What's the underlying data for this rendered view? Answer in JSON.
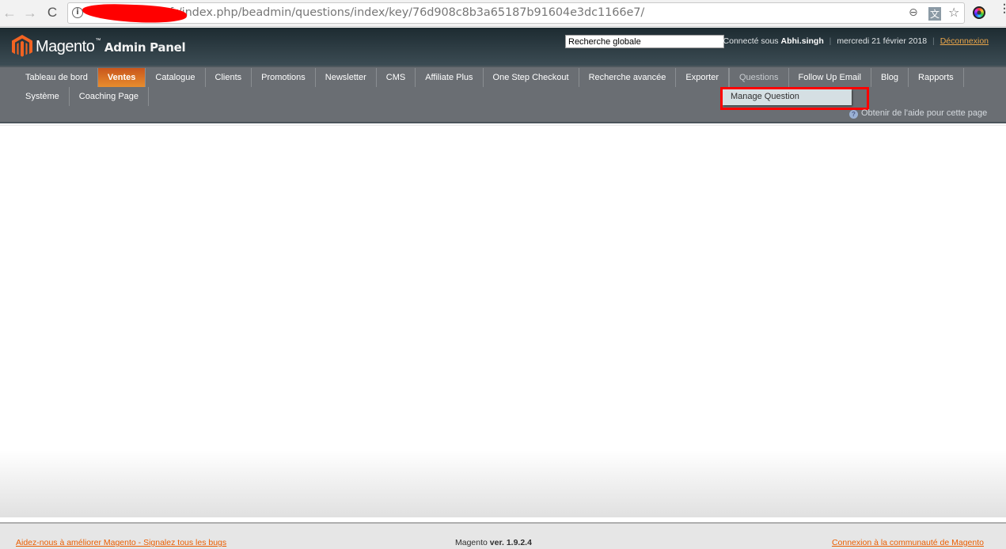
{
  "browser": {
    "back_icon": "←",
    "forward_icon": "→",
    "reload_icon": "C",
    "info_icon": "i",
    "url": "fr/index.php/beadmin/questions/index/key/76d908c8b3a65187b91604e3dc1166e7/",
    "zoom_icon": "⊖",
    "translate_icon": "文",
    "star_icon": "☆",
    "menu_icon": "⋮"
  },
  "header": {
    "logo_text": "Magento",
    "logo_tm": "™",
    "panel_text": "Admin Panel",
    "search_value": "Recherche globale",
    "connected_prefix": "Connecté sous",
    "username": "Abhi.singh",
    "date": "mercredi 21 février 2018",
    "separator": "|",
    "logout": "Déconnexion",
    "brand_color": "#f26322",
    "link_color": "#eba64a"
  },
  "nav": {
    "row1": [
      {
        "label": "Tableau de bord"
      },
      {
        "label": "Ventes",
        "active": true
      },
      {
        "label": "Catalogue"
      },
      {
        "label": "Clients"
      },
      {
        "label": "Promotions"
      },
      {
        "label": "Newsletter"
      },
      {
        "label": "CMS"
      },
      {
        "label": "Affiliate Plus"
      },
      {
        "label": "One Step Checkout"
      },
      {
        "label": "Recherche avancée"
      },
      {
        "label": "Exporter"
      },
      {
        "label": "Questions",
        "hover": true
      },
      {
        "label": "Follow Up Email"
      },
      {
        "label": "Blog"
      },
      {
        "label": "Rapports"
      }
    ],
    "row2": [
      {
        "label": "Système"
      },
      {
        "label": "Coaching Page"
      }
    ],
    "dropdown_item": "Manage Question",
    "help_icon": "?",
    "help_link": "Obtenir de l'aide pour cette page",
    "active_color": "#e0762a",
    "highlight_color": "#ff0000"
  },
  "footer": {
    "left_link": "Aidez-nous à améliorer Magento - Signalez tous les bugs",
    "version_prefix": "Magento",
    "version": "ver. 1.9.2.4",
    "right_link": "Connexion à la communauté de Magento"
  }
}
